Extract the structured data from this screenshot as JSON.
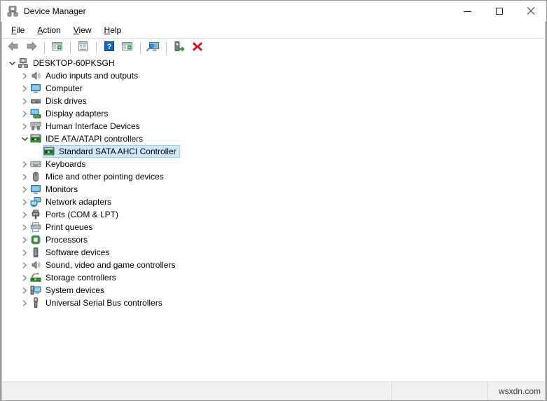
{
  "window": {
    "title": "Device Manager",
    "title_icon": "device-manager-icon",
    "controls": {
      "minimize": "minimize-icon",
      "maximize": "maximize-icon",
      "close": "close-icon"
    }
  },
  "menubar": {
    "items": [
      {
        "label": "File",
        "accel": "F"
      },
      {
        "label": "Action",
        "accel": "A"
      },
      {
        "label": "View",
        "accel": "V"
      },
      {
        "label": "Help",
        "accel": "H"
      }
    ]
  },
  "toolbar": {
    "buttons": [
      {
        "name": "back-icon",
        "kind": "arrow-left"
      },
      {
        "name": "forward-icon",
        "kind": "arrow-right"
      },
      {
        "name": "separator",
        "kind": "sep"
      },
      {
        "name": "show-hide-tree-icon",
        "kind": "window-tree"
      },
      {
        "name": "separator",
        "kind": "sep"
      },
      {
        "name": "properties-icon",
        "kind": "window-props"
      },
      {
        "name": "separator",
        "kind": "sep"
      },
      {
        "name": "help-icon",
        "kind": "help"
      },
      {
        "name": "update-driver-icon",
        "kind": "window-play"
      },
      {
        "name": "separator",
        "kind": "sep"
      },
      {
        "name": "scan-hardware-icon",
        "kind": "monitor-scan"
      },
      {
        "name": "separator",
        "kind": "sep"
      },
      {
        "name": "add-hardware-icon",
        "kind": "add-device"
      },
      {
        "name": "uninstall-device-icon",
        "kind": "red-x"
      }
    ]
  },
  "tree": {
    "nodes": [
      {
        "label": "DESKTOP-60PKSGH",
        "depth": 0,
        "state": "expanded",
        "icon": "computer-root-icon",
        "selected": false
      },
      {
        "label": "Audio inputs and outputs",
        "depth": 1,
        "state": "collapsed",
        "icon": "speaker-icon",
        "selected": false
      },
      {
        "label": "Computer",
        "depth": 1,
        "state": "collapsed",
        "icon": "monitor-icon",
        "selected": false
      },
      {
        "label": "Disk drives",
        "depth": 1,
        "state": "collapsed",
        "icon": "disk-drive-icon",
        "selected": false
      },
      {
        "label": "Display adapters",
        "depth": 1,
        "state": "collapsed",
        "icon": "display-adapter-icon",
        "selected": false
      },
      {
        "label": "Human Interface Devices",
        "depth": 1,
        "state": "collapsed",
        "icon": "hid-icon",
        "selected": false
      },
      {
        "label": "IDE ATA/ATAPI controllers",
        "depth": 1,
        "state": "expanded",
        "icon": "ide-controller-icon",
        "selected": false
      },
      {
        "label": "Standard SATA AHCI Controller",
        "depth": 2,
        "state": "leaf",
        "icon": "ide-controller-icon",
        "selected": true
      },
      {
        "label": "Keyboards",
        "depth": 1,
        "state": "collapsed",
        "icon": "keyboard-icon",
        "selected": false
      },
      {
        "label": "Mice and other pointing devices",
        "depth": 1,
        "state": "collapsed",
        "icon": "mouse-icon",
        "selected": false
      },
      {
        "label": "Monitors",
        "depth": 1,
        "state": "collapsed",
        "icon": "monitor-icon",
        "selected": false
      },
      {
        "label": "Network adapters",
        "depth": 1,
        "state": "collapsed",
        "icon": "network-adapter-icon",
        "selected": false
      },
      {
        "label": "Ports (COM & LPT)",
        "depth": 1,
        "state": "collapsed",
        "icon": "port-icon",
        "selected": false
      },
      {
        "label": "Print queues",
        "depth": 1,
        "state": "collapsed",
        "icon": "printer-icon",
        "selected": false
      },
      {
        "label": "Processors",
        "depth": 1,
        "state": "collapsed",
        "icon": "processor-icon",
        "selected": false
      },
      {
        "label": "Software devices",
        "depth": 1,
        "state": "collapsed",
        "icon": "software-device-icon",
        "selected": false
      },
      {
        "label": "Sound, video and game controllers",
        "depth": 1,
        "state": "collapsed",
        "icon": "speaker-icon",
        "selected": false
      },
      {
        "label": "Storage controllers",
        "depth": 1,
        "state": "collapsed",
        "icon": "storage-controller-icon",
        "selected": false
      },
      {
        "label": "System devices",
        "depth": 1,
        "state": "collapsed",
        "icon": "system-device-icon",
        "selected": false
      },
      {
        "label": "Universal Serial Bus controllers",
        "depth": 1,
        "state": "collapsed",
        "icon": "usb-icon",
        "selected": false
      }
    ]
  },
  "statusbar": {
    "main": "",
    "mid": "",
    "watermark": "wsxdn.com"
  },
  "colors": {
    "selection_fill": "#cce8ff",
    "selection_border": "#99d1ff",
    "chrome": "#ffffff",
    "statusbar": "#f0f0f0",
    "danger": "#d01a1a"
  }
}
